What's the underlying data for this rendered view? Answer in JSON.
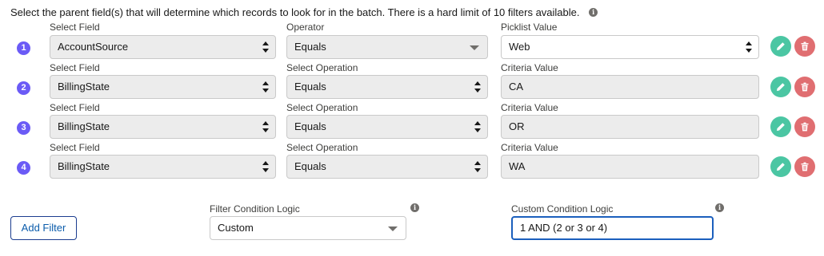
{
  "intro_text": "Select the parent field(s) that will determine which records to look for in the batch. There is a hard limit of 10 filters available.",
  "filters": [
    {
      "number": "1",
      "field_label": "Select Field",
      "field_value": "AccountSource",
      "op_label": "Operator",
      "op_value": "Equals",
      "value_label": "Picklist Value",
      "value": "Web"
    },
    {
      "number": "2",
      "field_label": "Select Field",
      "field_value": "BillingState",
      "op_label": "Select Operation",
      "op_value": "Equals",
      "value_label": "Criteria Value",
      "value": "CA"
    },
    {
      "number": "3",
      "field_label": "Select Field",
      "field_value": "BillingState",
      "op_label": "Select Operation",
      "op_value": "Equals",
      "value_label": "Criteria Value",
      "value": "OR"
    },
    {
      "number": "4",
      "field_label": "Select Field",
      "field_value": "BillingState",
      "op_label": "Select Operation",
      "op_value": "Equals",
      "value_label": "Criteria Value",
      "value": "WA"
    }
  ],
  "footer": {
    "add_filter_label": "Add Filter",
    "logic_label": "Filter Condition Logic",
    "logic_value": "Custom",
    "custom_label": "Custom Condition Logic",
    "custom_value": "1 AND (2 or 3 or 4)"
  },
  "colors": {
    "step_badge": "#6b5bf6",
    "edit_button": "#4bc6a3",
    "delete_button": "#e06e71",
    "focus_border": "#1b5fbd"
  },
  "icons": {
    "edit": "pencil-icon",
    "delete": "trash-icon",
    "info": "info-icon"
  }
}
